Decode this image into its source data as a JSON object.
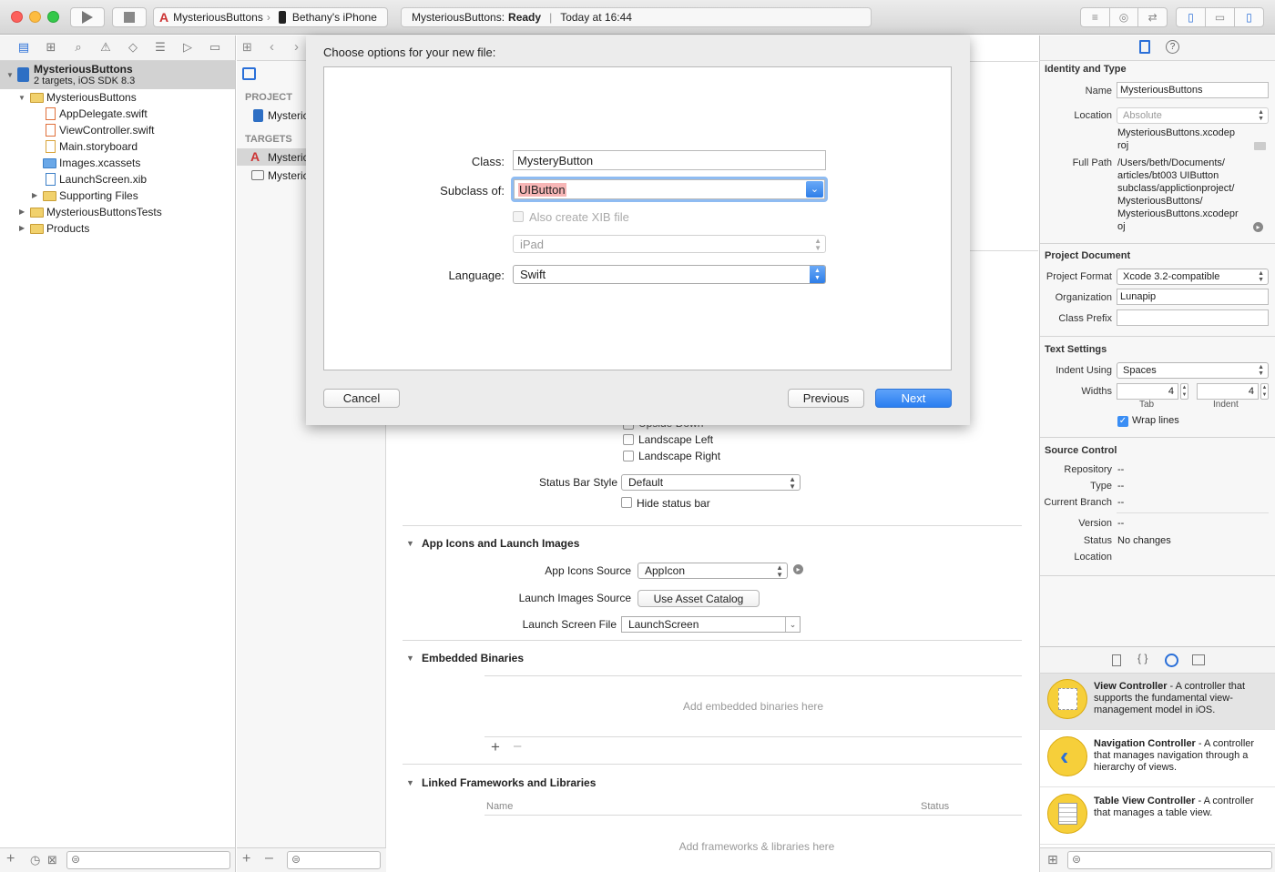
{
  "toolbar": {
    "scheme": "MysteriousButtons",
    "device": "Bethany's iPhone",
    "status_app": "MysteriousButtons:",
    "status_state": "Ready",
    "status_time": "Today at 16:44"
  },
  "navigator": {
    "project_name": "MysteriousButtons",
    "project_sub": "2 targets, iOS SDK 8.3",
    "items": [
      {
        "label": "MysteriousButtons",
        "kind": "folder"
      },
      {
        "label": "AppDelegate.swift",
        "kind": "swift-file"
      },
      {
        "label": "ViewController.swift",
        "kind": "swift-file"
      },
      {
        "label": "Main.storyboard",
        "kind": "storyboard-file"
      },
      {
        "label": "Images.xcassets",
        "kind": "assets-folder"
      },
      {
        "label": "LaunchScreen.xib",
        "kind": "xib-file"
      },
      {
        "label": "Supporting Files",
        "kind": "folder"
      },
      {
        "label": "MysteriousButtonsTests",
        "kind": "folder"
      },
      {
        "label": "Products",
        "kind": "folder"
      }
    ]
  },
  "targets": {
    "project_header": "PROJECT",
    "project_item": "Mysteric",
    "targets_header": "TARGETS",
    "target_items": [
      "Mysteric",
      "Mysteric"
    ]
  },
  "settings": {
    "landscape_left": "Landscape Left",
    "landscape_right": "Landscape Right",
    "upside_down_partial": "Upside Down",
    "status_bar_style_label": "Status Bar Style",
    "status_bar_style_value": "Default",
    "hide_status_bar": "Hide status bar",
    "app_icons_section": "App Icons and Launch Images",
    "app_icons_source_label": "App Icons Source",
    "app_icons_source_value": "AppIcon",
    "launch_images_source_label": "Launch Images Source",
    "launch_images_source_button": "Use Asset Catalog",
    "launch_screen_file_label": "Launch Screen File",
    "launch_screen_file_value": "LaunchScreen",
    "embedded_binaries_section": "Embedded Binaries",
    "embedded_placeholder": "Add embedded binaries here",
    "linked_section": "Linked Frameworks and Libraries",
    "linked_col_name": "Name",
    "linked_col_status": "Status",
    "linked_placeholder": "Add frameworks & libraries here"
  },
  "sheet": {
    "title": "Choose options for your new file:",
    "class_label": "Class:",
    "class_value": "MysteryButton",
    "subclass_label": "Subclass of:",
    "subclass_value": "UIButton",
    "xib_label": "Also create XIB file",
    "device_value": "iPad",
    "language_label": "Language:",
    "language_value": "Swift",
    "cancel": "Cancel",
    "previous": "Previous",
    "next": "Next",
    "accent": "#3a8ef5"
  },
  "inspector": {
    "identity_header": "Identity and Type",
    "name_label": "Name",
    "name_value": "MysteriousButtons",
    "location_label": "Location",
    "location_value": "Absolute",
    "location_path_1": "MysteriousButtons.xcodep",
    "location_path_2": "roj",
    "full_path_label": "Full Path",
    "full_path_lines": [
      "/Users/beth/Documents/",
      "articles/bt003 UIButton",
      "subclass/applictionproject/",
      "MysteriousButtons/",
      "MysteriousButtons.xcodepr",
      "oj"
    ],
    "project_doc_header": "Project Document",
    "project_format_label": "Project Format",
    "project_format_value": "Xcode 3.2-compatible",
    "organization_label": "Organization",
    "organization_value": "Lunapip",
    "class_prefix_label": "Class Prefix",
    "class_prefix_value": "",
    "text_settings_header": "Text Settings",
    "indent_using_label": "Indent Using",
    "indent_using_value": "Spaces",
    "widths_label": "Widths",
    "tab_width": "4",
    "indent_width": "4",
    "tab_label": "Tab",
    "indent_label": "Indent",
    "wrap_lines": "Wrap lines",
    "source_control_header": "Source Control",
    "repository_label": "Repository",
    "repository_value": "--",
    "type_label": "Type",
    "type_value": "--",
    "branch_label": "Current Branch",
    "branch_value": "--",
    "version_label": "Version",
    "version_value": "--",
    "status_label": "Status",
    "status_value": "No changes",
    "sc_location_label": "Location"
  },
  "library": {
    "items": [
      {
        "title": "View Controller",
        "desc": " - A controller that supports the fundamental view-management model in iOS."
      },
      {
        "title": "Navigation Controller",
        "desc": " - A controller that manages navigation through a hierarchy of views."
      },
      {
        "title": "Table View Controller",
        "desc": " - A controller that manages a table view."
      }
    ]
  }
}
